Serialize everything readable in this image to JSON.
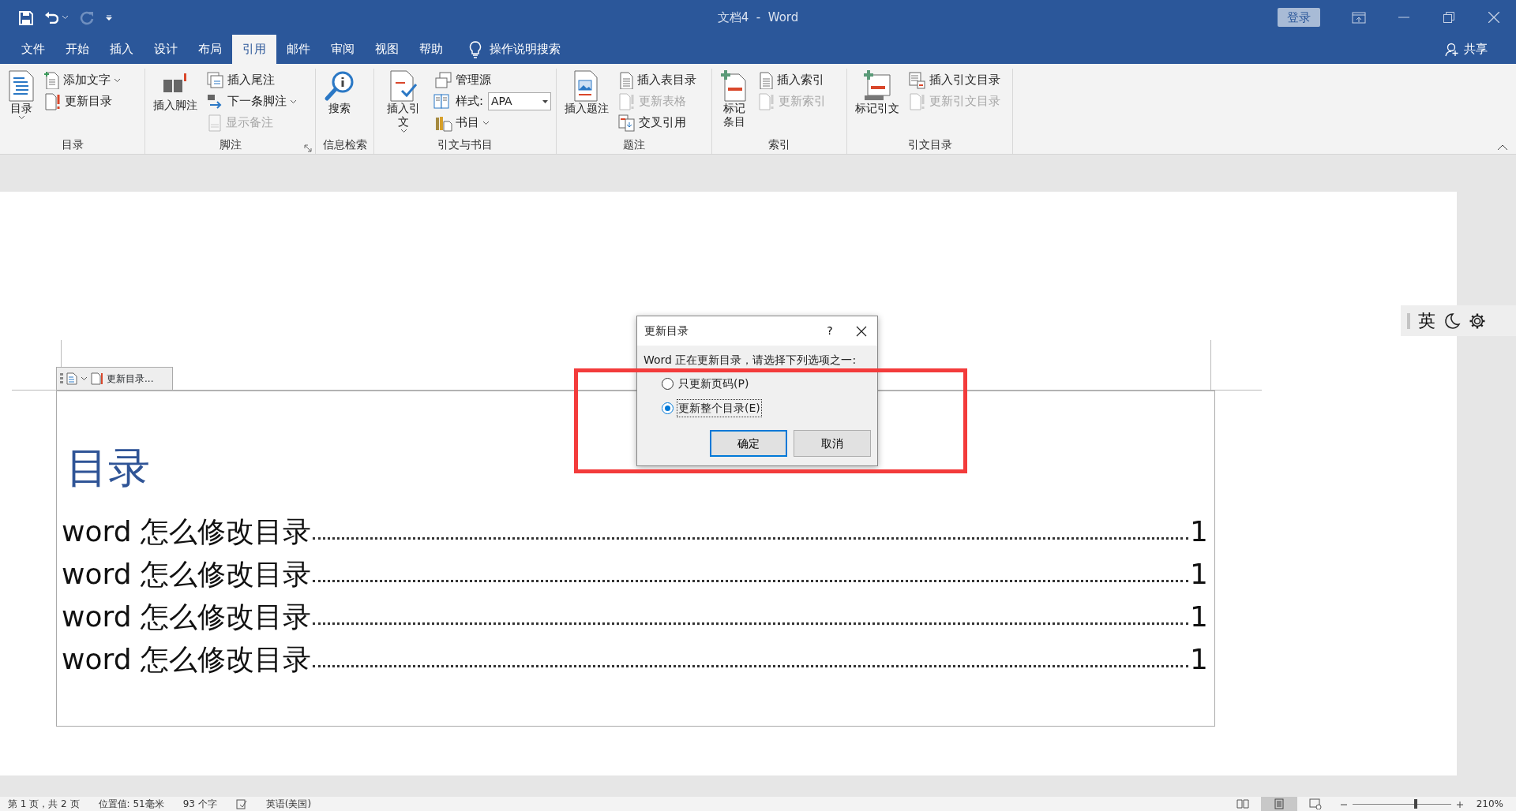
{
  "window": {
    "title": "文档4  -  Word",
    "sign_in": "登录"
  },
  "ribbon_tabs": [
    {
      "label": "文件",
      "selected": false
    },
    {
      "label": "开始",
      "selected": false
    },
    {
      "label": "插入",
      "selected": false
    },
    {
      "label": "设计",
      "selected": false
    },
    {
      "label": "布局",
      "selected": false
    },
    {
      "label": "引用",
      "selected": true
    },
    {
      "label": "邮件",
      "selected": false
    },
    {
      "label": "审阅",
      "selected": false
    },
    {
      "label": "视图",
      "selected": false
    },
    {
      "label": "帮助",
      "selected": false
    }
  ],
  "tell_me": "操作说明搜索",
  "share": "共享",
  "ribbon_groups": [
    {
      "label": "目录",
      "large": {
        "label": "目录",
        "dropdown": true
      },
      "small": [
        {
          "kind": "button",
          "label": "添加文字",
          "dropdown": true,
          "disabled": false
        },
        {
          "kind": "button",
          "label": "更新目录",
          "dropdown": false,
          "disabled": false
        }
      ]
    },
    {
      "label": "脚注",
      "launcher": true,
      "large": {
        "label": "插入脚注",
        "dropdown": false
      },
      "small": [
        {
          "kind": "button",
          "label": "插入尾注",
          "dropdown": false,
          "disabled": false
        },
        {
          "kind": "button",
          "label": "下一条脚注",
          "dropdown": true,
          "disabled": false
        },
        {
          "kind": "button",
          "label": "显示备注",
          "dropdown": false,
          "disabled": true
        }
      ]
    },
    {
      "label": "信息检索",
      "large": {
        "label": "搜索",
        "dropdown": false
      }
    },
    {
      "label": "引文与书目",
      "large": {
        "label": "插入引文",
        "dropdown": true
      },
      "small": [
        {
          "kind": "button",
          "label": "管理源",
          "dropdown": false,
          "disabled": false
        },
        {
          "kind": "combo",
          "label": "样式:",
          "value": "APA",
          "dropdown": true,
          "disabled": false
        },
        {
          "kind": "button",
          "label": "书目",
          "dropdown": true,
          "disabled": false
        }
      ]
    },
    {
      "label": "题注",
      "large": {
        "label": "插入题注",
        "dropdown": false
      },
      "small": [
        {
          "kind": "button",
          "label": "插入表目录",
          "dropdown": false,
          "disabled": false
        },
        {
          "kind": "button",
          "label": "更新表格",
          "dropdown": false,
          "disabled": true
        },
        {
          "kind": "button",
          "label": "交叉引用",
          "dropdown": false,
          "disabled": false
        }
      ]
    },
    {
      "label": "索引",
      "large": {
        "label": "标记条目",
        "dropdown": false
      },
      "small": [
        {
          "kind": "button",
          "label": "插入索引",
          "dropdown": false,
          "disabled": false
        },
        {
          "kind": "button",
          "label": "更新索引",
          "dropdown": false,
          "disabled": true
        }
      ]
    },
    {
      "label": "引文目录",
      "large": {
        "label": "标记引文",
        "dropdown": false
      },
      "small": [
        {
          "kind": "button",
          "label": "插入引文目录",
          "dropdown": false,
          "disabled": false
        },
        {
          "kind": "button",
          "label": "更新引文目录",
          "dropdown": false,
          "disabled": true
        }
      ]
    }
  ],
  "document": {
    "content_control_tab": "更新目录...",
    "heading": "目录",
    "toc": [
      {
        "text": "word 怎么修改目录",
        "page": "1"
      },
      {
        "text": "word 怎么修改目录",
        "page": "1"
      },
      {
        "text": "word 怎么修改目录",
        "page": "1"
      },
      {
        "text": "word 怎么修改目录",
        "page": "1"
      }
    ]
  },
  "dialog": {
    "title": "更新目录",
    "help": "?",
    "message": "Word 正在更新目录，请选择下列选项之一:",
    "options": [
      {
        "label": "只更新页码(P)",
        "selected": false
      },
      {
        "label": "更新整个目录(E)",
        "selected": true
      }
    ],
    "buttons": [
      {
        "label": "确定",
        "default": true
      },
      {
        "label": "取消",
        "default": false
      }
    ]
  },
  "ime": {
    "mode": "英"
  },
  "status_bar": {
    "page": "第 1 页，共 2 页",
    "position": "位置值: 51毫米",
    "words": "93 个字",
    "language": "英语(美国)",
    "views": [
      {
        "selected": false
      },
      {
        "selected": true
      },
      {
        "selected": false
      }
    ],
    "zoom": {
      "level": 0.64,
      "reading": "210%"
    }
  }
}
